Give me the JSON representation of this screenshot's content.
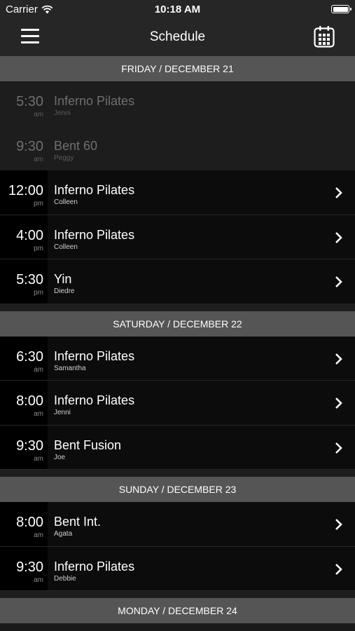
{
  "status": {
    "carrier": "Carrier",
    "time": "10:18 AM"
  },
  "navbar": {
    "title": "Schedule"
  },
  "colors": {
    "accent": "#ffffff",
    "section_bg": "#555555",
    "row_bg": "#0c0c0c"
  },
  "sections": [
    {
      "header": "FRIDAY / DECEMBER 21",
      "rows": [
        {
          "time": "5:30",
          "ampm": "am",
          "name": "Inferno Pilates",
          "instructor": "Jenni"
        },
        {
          "time": "9:30",
          "ampm": "am",
          "name": "Bent 60",
          "instructor": "Peggy"
        },
        {
          "time": "12:00",
          "ampm": "pm",
          "name": "Inferno Pilates",
          "instructor": "Colleen"
        },
        {
          "time": "4:00",
          "ampm": "pm",
          "name": "Inferno Pilates",
          "instructor": "Colleen"
        },
        {
          "time": "5:30",
          "ampm": "pm",
          "name": "Yin",
          "instructor": "Diedre"
        }
      ]
    },
    {
      "header": "SATURDAY / DECEMBER 22",
      "rows": [
        {
          "time": "6:30",
          "ampm": "am",
          "name": "Inferno Pilates",
          "instructor": "Samantha"
        },
        {
          "time": "8:00",
          "ampm": "am",
          "name": "Inferno Pilates",
          "instructor": "Jenni"
        },
        {
          "time": "9:30",
          "ampm": "am",
          "name": "Bent Fusion",
          "instructor": "Joe"
        }
      ]
    },
    {
      "header": "SUNDAY / DECEMBER 23",
      "rows": [
        {
          "time": "8:00",
          "ampm": "am",
          "name": "Bent Int.",
          "instructor": "Agata"
        },
        {
          "time": "9:30",
          "ampm": "am",
          "name": "Inferno Pilates",
          "instructor": "Debbie"
        }
      ]
    },
    {
      "header": "MONDAY / DECEMBER 24",
      "rows": []
    }
  ]
}
